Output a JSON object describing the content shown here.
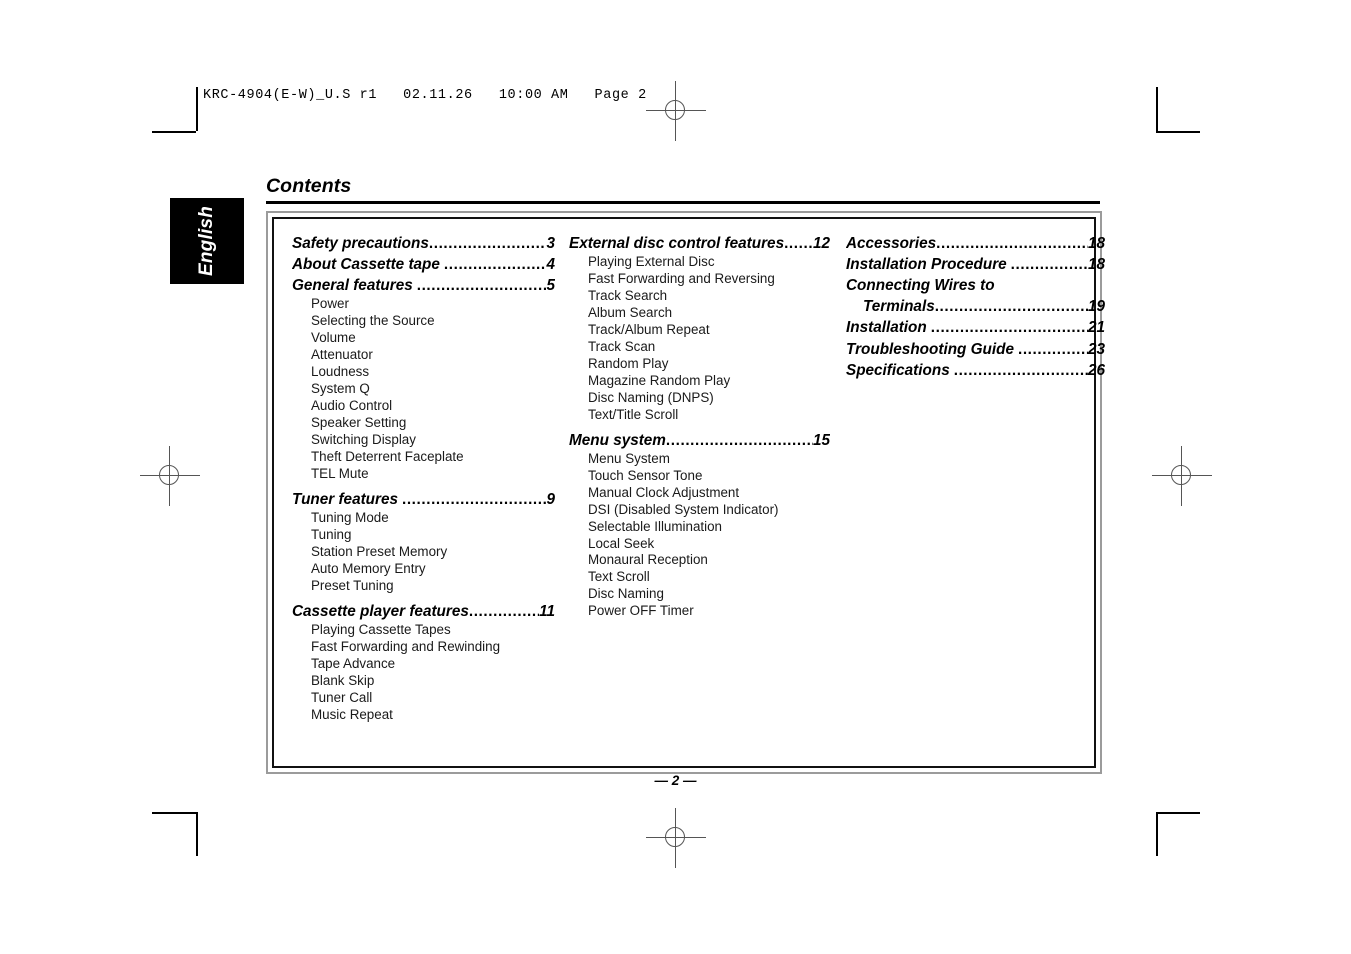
{
  "file_header": "KRC-4904(E-W)_U.S r1   02.11.26   10:00 AM   Page 2",
  "language_tab": "English",
  "page_title": "Contents",
  "page_footer": "— 2 —",
  "leader_dots": "..............................................................",
  "columns": [
    {
      "name": "column-1",
      "blocks": [
        {
          "major": {
            "text": "Safety precautions",
            "page": "3",
            "gap": false
          },
          "subs": []
        },
        {
          "major": {
            "text": "About Cassette tape",
            "page": "4",
            "gap": true
          },
          "subs": []
        },
        {
          "major": {
            "text": "General features",
            "page": "5",
            "gap": true
          },
          "subs": [
            "Power",
            "Selecting the Source",
            "Volume",
            "Attenuator",
            "Loudness",
            "System Q",
            "Audio Control",
            "Speaker Setting",
            "Switching Display",
            "Theft Deterrent Faceplate",
            "TEL Mute"
          ]
        },
        {
          "major": {
            "text": "Tuner features",
            "page": "9",
            "gap": true
          },
          "subs": [
            "Tuning Mode",
            "Tuning",
            "Station Preset Memory",
            "Auto Memory Entry",
            "Preset Tuning"
          ]
        },
        {
          "major": {
            "text": "Cassette player features",
            "page": "11",
            "gap": false
          },
          "subs": [
            "Playing Cassette Tapes",
            "Fast Forwarding and Rewinding",
            "Tape Advance",
            "Blank Skip",
            "Tuner Call",
            "Music Repeat"
          ]
        }
      ]
    },
    {
      "name": "column-2",
      "blocks": [
        {
          "major": {
            "text": "External disc control features",
            "page": "12",
            "gap": false
          },
          "subs": [
            "Playing External Disc",
            "Fast Forwarding and Reversing",
            "Track Search",
            "Album Search",
            "Track/Album Repeat",
            "Track Scan",
            "Random Play",
            "Magazine Random Play",
            "Disc Naming (DNPS)",
            "Text/Title Scroll"
          ]
        },
        {
          "major": {
            "text": "Menu system",
            "page": "15",
            "gap": false
          },
          "subs": [
            "Menu System",
            "Touch Sensor Tone",
            "Manual Clock Adjustment",
            "DSI (Disabled System Indicator)",
            "Selectable Illumination",
            "Local Seek",
            "Monaural Reception",
            "Text Scroll",
            "Disc Naming",
            "Power OFF Timer"
          ]
        }
      ]
    },
    {
      "name": "column-3",
      "blocks": [
        {
          "major": {
            "text": "Accessories",
            "page": "18",
            "gap": false
          },
          "subs": []
        },
        {
          "major": {
            "text": "Installation Procedure",
            "page": "18",
            "gap": true
          },
          "subs": []
        },
        {
          "major": {
            "text": "Connecting Wires to",
            "text2": "Terminals",
            "page": "19",
            "gap": false,
            "wrap": true
          },
          "subs": []
        },
        {
          "major": {
            "text": "Installation",
            "page": "21",
            "gap": true
          },
          "subs": []
        },
        {
          "major": {
            "text": "Troubleshooting Guide",
            "page": "23",
            "gap": true
          },
          "subs": []
        },
        {
          "major": {
            "text": "Specifications",
            "page": "26",
            "gap": true
          },
          "subs": []
        }
      ]
    }
  ]
}
